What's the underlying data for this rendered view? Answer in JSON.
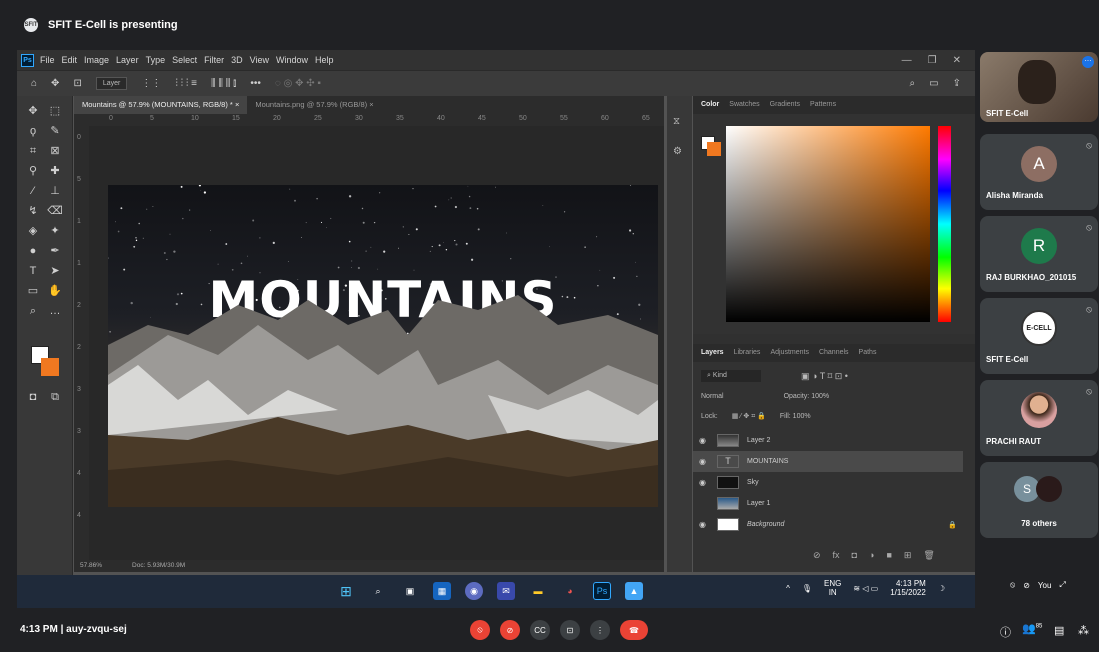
{
  "meet": {
    "presenter_banner": "SFIT E-Cell is presenting",
    "time": "4:13 PM",
    "separator": "|",
    "meeting_code": "auy-zvqu-sej",
    "participants": [
      {
        "name": "SFIT E-Cell",
        "initial": ""
      },
      {
        "name": "Alisha Miranda",
        "initial": "A",
        "color": "#8d6e63"
      },
      {
        "name": "RAJ BURKHAO_201015",
        "initial": "R",
        "color": "#1e7a4b"
      },
      {
        "name": "SFIT E-Cell",
        "initial": "E-CELL",
        "color": "#ffffff"
      },
      {
        "name": "PRACHI RAUT",
        "initial": "",
        "color": "#c88"
      },
      {
        "name": "78 others",
        "initial": "S",
        "color": "#78909c"
      }
    ],
    "self_label": "You",
    "people_count": "85"
  },
  "photoshop": {
    "menu": [
      "File",
      "Edit",
      "Image",
      "Layer",
      "Type",
      "Select",
      "Filter",
      "3D",
      "View",
      "Window",
      "Help"
    ],
    "option_layer": "Layer",
    "tabs": [
      {
        "label": "Mountains @ 57.9% (MOUNTAINS, RGB/8) *",
        "active": true
      },
      {
        "label": "Mountains.png @ 57.9% (RGB/8)",
        "active": false
      }
    ],
    "ruler_top": [
      "0",
      "5",
      "10",
      "15",
      "20",
      "25",
      "30",
      "35",
      "40",
      "45",
      "50",
      "55",
      "60",
      "65"
    ],
    "ruler_left": [
      "0",
      "5",
      "1",
      "1",
      "2",
      "2",
      "3",
      "3",
      "4",
      "4"
    ],
    "headline": "MOUNTAINS",
    "zoom": "57.86%",
    "doc_size": "Doc: 5.93M/30.9M",
    "color_tabs": [
      "Color",
      "Swatches",
      "Gradients",
      "Patterns"
    ],
    "layer_tabs": [
      "Layers",
      "Libraries",
      "Adjustments",
      "Channels",
      "Paths"
    ],
    "kind_label": "Kind",
    "blend_mode": "Normal",
    "opacity_label": "Opacity:",
    "opacity_value": "100%",
    "lock_label": "Lock:",
    "fill_label": "Fill:",
    "fill_value": "100%",
    "layers": [
      {
        "name": "Layer 2",
        "selected": false
      },
      {
        "name": "MOUNTAINS",
        "selected": true
      },
      {
        "name": "Sky",
        "selected": false
      },
      {
        "name": "Layer 1",
        "selected": false
      },
      {
        "name": "Background",
        "selected": false
      }
    ],
    "fg_color": "#ffffff",
    "bg_color": "#f07820"
  },
  "windows": {
    "lang": "ENG",
    "region": "IN",
    "time": "4:13 PM",
    "date": "1/15/2022"
  },
  "colors": {
    "leave_red": "#ea4335",
    "accent_orange": "#f07820"
  }
}
